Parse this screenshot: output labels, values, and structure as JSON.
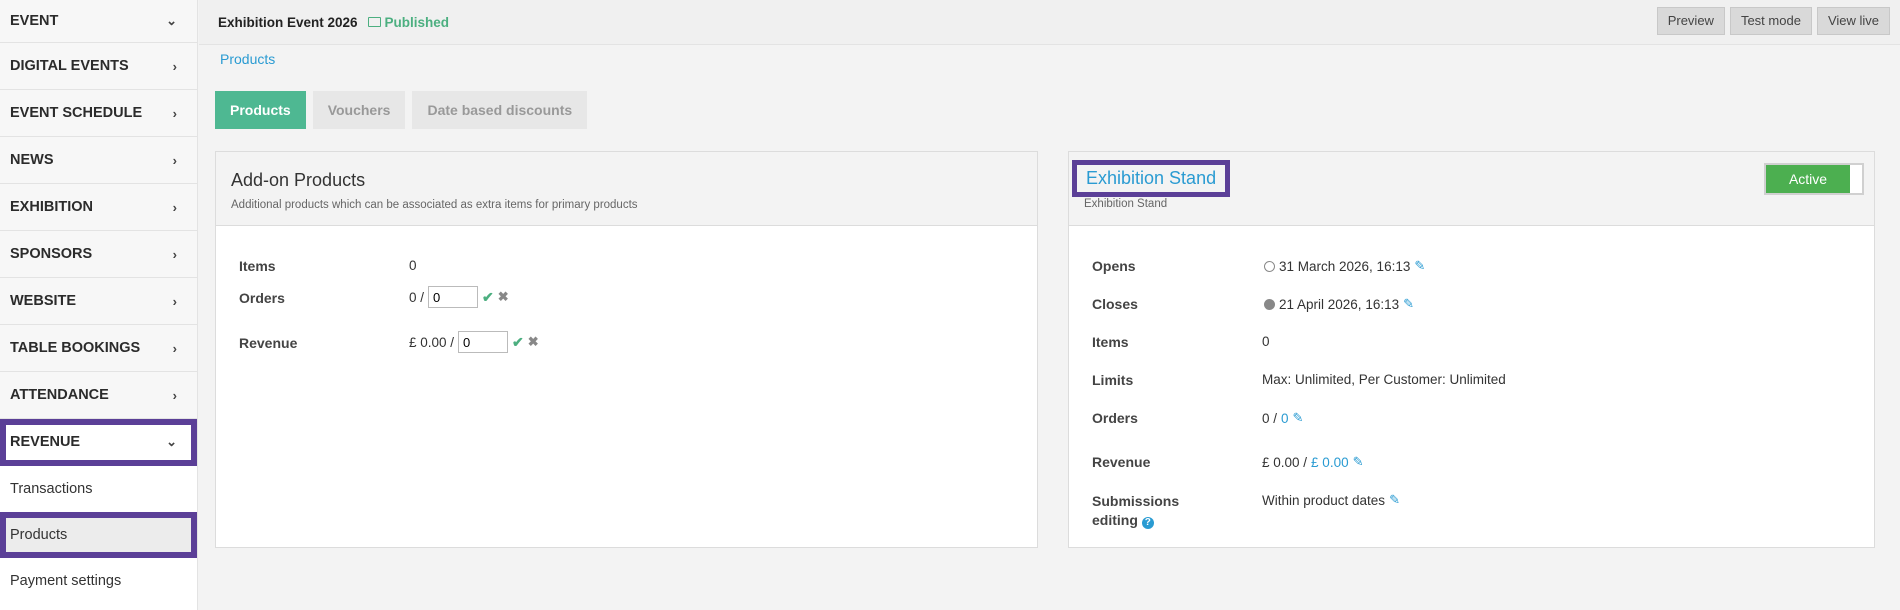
{
  "sidebar": {
    "items": [
      {
        "label": "EVENT",
        "chevron": "chevron-down"
      },
      {
        "label": "DIGITAL EVENTS",
        "chevron": "chevron-right"
      },
      {
        "label": "EVENT SCHEDULE",
        "chevron": "chevron-right"
      },
      {
        "label": "NEWS",
        "chevron": "chevron-right"
      },
      {
        "label": "EXHIBITION",
        "chevron": "chevron-right"
      },
      {
        "label": "SPONSORS",
        "chevron": "chevron-right"
      },
      {
        "label": "WEBSITE",
        "chevron": "chevron-right"
      },
      {
        "label": "TABLE BOOKINGS",
        "chevron": "chevron-right"
      },
      {
        "label": "ATTENDANCE",
        "chevron": "chevron-right"
      },
      {
        "label": "REVENUE",
        "chevron": "chevron-down"
      }
    ],
    "sub_items": [
      {
        "label": "Transactions"
      },
      {
        "label": "Products"
      },
      {
        "label": "Payment settings"
      }
    ]
  },
  "header": {
    "event_title": "Exhibition Event 2026",
    "status": "Published",
    "actions": {
      "preview": "Preview",
      "test_mode": "Test mode",
      "view_live": "View live"
    }
  },
  "breadcrumb": "Products",
  "tabs": [
    {
      "label": "Products",
      "active": true
    },
    {
      "label": "Vouchers",
      "active": false
    },
    {
      "label": "Date based discounts",
      "active": false
    }
  ],
  "addon_panel": {
    "title": "Add-on Products",
    "subtitle": "Additional products which can be associated as extra items for primary products",
    "items_label": "Items",
    "items_value": "0",
    "orders_label": "Orders",
    "orders_prefix": "0 /",
    "orders_input": "0",
    "revenue_label": "Revenue",
    "revenue_prefix": "£ 0.00 /",
    "revenue_input": "0"
  },
  "stand_panel": {
    "title": "Exhibition Stand",
    "subtitle": "Exhibition Stand",
    "toggle_label": "Active",
    "opens_label": "Opens",
    "opens_value": "31 March 2026, 16:13",
    "closes_label": "Closes",
    "closes_value": "21 April 2026, 16:13",
    "items_label": "Items",
    "items_value": "0",
    "limits_label": "Limits",
    "limits_value": "Max: Unlimited, Per Customer: Unlimited",
    "orders_label": "Orders",
    "orders_prefix": "0 /",
    "orders_link": "0",
    "revenue_label": "Revenue",
    "revenue_prefix": "£ 0.00 /",
    "revenue_link": "£ 0.00",
    "submissions_label_1": "Submissions",
    "submissions_label_2": "editing",
    "submissions_value": "Within product dates"
  },
  "colors": {
    "accent_green": "#4eb892",
    "link_blue": "#2a9bd2",
    "highlight_purple": "#5b3f97",
    "toggle_green": "#4caf50"
  }
}
